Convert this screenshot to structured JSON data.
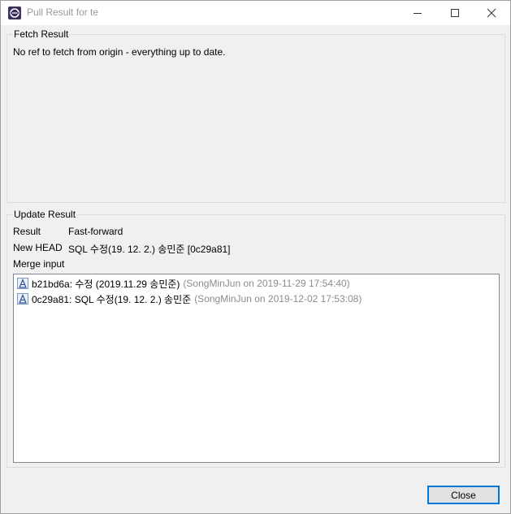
{
  "window": {
    "title": "Pull Result for te"
  },
  "fetch_result": {
    "heading": "Fetch Result",
    "message": "No ref to fetch from origin - everything up to date."
  },
  "update_result": {
    "heading": "Update Result",
    "result_label": "Result",
    "result_value": "Fast-forward",
    "new_head_label": "New HEAD",
    "new_head_value": "SQL 수정(19. 12. 2.) 송민준 [0c29a81]",
    "merge_input_label": "Merge input",
    "merge_input": [
      {
        "main": "b21bd6a: 수정 (2019.11.29 송민준)",
        "meta": "(SongMinJun on 2019-11-29 17:54:40)",
        "icon": "commit-icon"
      },
      {
        "main": "0c29a81: SQL 수정(19. 12. 2.) 송민준",
        "meta": "(SongMinJun on 2019-12-02 17:53:08)",
        "icon": "commit-icon"
      }
    ]
  },
  "buttons": {
    "close_label": "Close"
  },
  "colors": {
    "accent": "#0078d7",
    "meta_text": "#8c8c8c",
    "dialog_bg": "#f0f0f0"
  }
}
